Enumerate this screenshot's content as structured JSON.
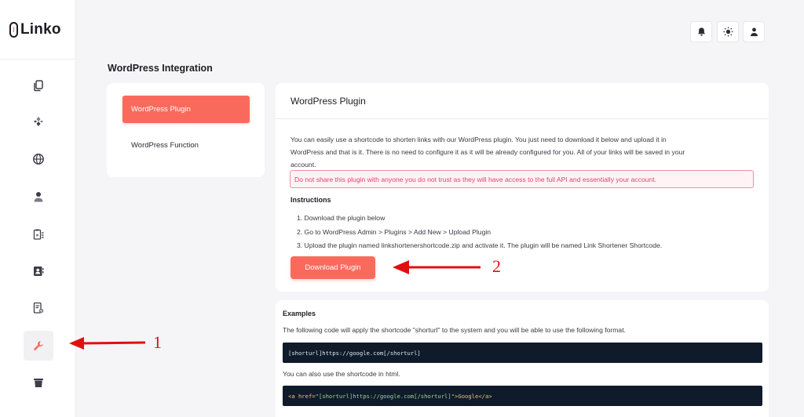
{
  "app": {
    "logo_text": "Linko"
  },
  "sidebar": {
    "items": [
      {
        "icon": "copy-icon"
      },
      {
        "icon": "puzzle-icon"
      },
      {
        "icon": "globe-icon"
      },
      {
        "icon": "user-icon"
      },
      {
        "icon": "clipboard-list-icon"
      },
      {
        "icon": "contact-card-icon"
      },
      {
        "icon": "document-settings-icon"
      },
      {
        "icon": "wrench-icon",
        "active": true
      },
      {
        "icon": "trash-icon"
      }
    ]
  },
  "header": {
    "icons": [
      "bell-icon",
      "sun-icon",
      "user-icon"
    ]
  },
  "page": {
    "title": "WordPress Integration"
  },
  "menu": {
    "items": [
      {
        "label": "WordPress Plugin",
        "active": true
      },
      {
        "label": "WordPress Function",
        "active": false
      }
    ]
  },
  "plugin_card": {
    "title": "WordPress Plugin",
    "description_line1": "You can easily use a shortcode to shorten links with our WordPress plugin. You just need to download it below and upload it in",
    "description_line2": "WordPress and that is it. There is no need to configure it as it will be already configured for you. All of your links will be saved in your",
    "description_line3": "account.",
    "alert": "Do not share this plugin with anyone you do not trust as they will have access to the full API and essentially your account.",
    "instructions_title": "Instructions",
    "steps": [
      "1. Download the plugin below",
      "2. Go to WordPress Admin > Plugins > Add New > Upload Plugin",
      "3. Upload the plugin named linkshortenershortcode.zip and activate it. The plugin will be named Link Shortener Shortcode."
    ],
    "download_label": "Download Plugin"
  },
  "examples": {
    "title": "Examples",
    "text1": "The following code will apply the shortcode \"shorturl\" to the system and you will be able to use the following format.",
    "code1": "[shorturl]https://google.com[/shorturl]",
    "text2": "You can also use the shortcode in html.",
    "code2_open": "<a href=",
    "code2_string": "\"[shorturl]https://google.com[/shorturl]\"",
    "code2_close": ">Google</a>"
  },
  "annotations": {
    "label1": "1",
    "label2": "2"
  },
  "colors": {
    "accent": "#f96a5d",
    "annotation": "#e01010"
  }
}
